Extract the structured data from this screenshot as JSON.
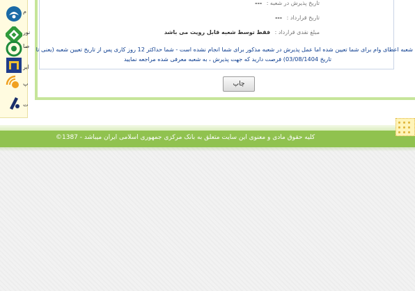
{
  "banks": [
    {
      "name": "bank-logo-1-icon",
      "label": "م",
      "color": "#1a6aa6"
    },
    {
      "name": "bank-logo-2-icon",
      "label": "نور",
      "color": "#2f9a3a"
    },
    {
      "name": "bank-logo-3-icon",
      "label": "صا",
      "color": "#1e8a3a"
    },
    {
      "name": "bank-logo-4-icon",
      "label": "ایر",
      "color": "#1f3c8a"
    },
    {
      "name": "bank-logo-5-icon",
      "label": "پ",
      "color": "#f0a020"
    },
    {
      "name": "bank-logo-6-icon",
      "label": "ت",
      "color": "#1a2f6a"
    }
  ],
  "info": {
    "acceptance_date_label": "تاریخ پذیرش در شعبه :",
    "acceptance_date_value": "---",
    "contract_date_label": "تاریخ قرارداد :",
    "contract_date_value": "---",
    "contract_amount_label": "مبلغ نقدی قرارداد :",
    "contract_amount_value": "فقط توسط شعبه قابل رویت می باشد"
  },
  "notice": {
    "line1": "شعبه اعطای وام برای شما تعیین شده اما عمل پذیرش در شعبه مذکور برای شما انجام نشده است - شما حداکثر 12 روز کاری پس از تاریخ تعیین شعبه (یعنی تا",
    "line2": "تاریخ 03/08/1404) فرصت دارید که جهت پذیرش ، به شعبه معرفی شده مراجعه نمایید"
  },
  "print_button": "چاپ",
  "footer": {
    "copyright": "کلیه حقوق مادی و معنوی این سایت متعلق به بانک مرکزی جمهوری اسلامی ایران میباشد - 1387©"
  },
  "colors": {
    "footer_green": "#90c24f",
    "frame_green": "#c6e59a",
    "notice_blue": "#0b3c8f"
  }
}
